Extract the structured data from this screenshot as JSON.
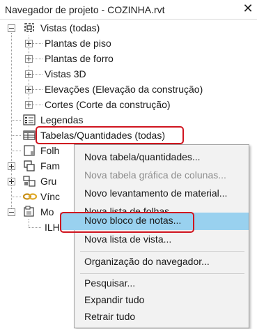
{
  "window": {
    "title": "Navegador de projeto - COZINHA.rvt",
    "close_glyph": "✕"
  },
  "tree": {
    "views_root": "Vistas (todas)",
    "views_children": [
      "Plantas de piso",
      "Plantas de forro",
      "Vistas 3D",
      "Elevações (Elevação da construção)",
      "Cortes (Corte da construção)"
    ],
    "legends": "Legendas",
    "schedules": "Tabelas/Quantidades (todas)",
    "sheets_partial": "Folh",
    "families_partial": "Fam",
    "groups_partial": "Gru",
    "links_partial": "Vínc",
    "model_partial": "Mo",
    "model_child_partial": "ILH"
  },
  "context_menu": {
    "items": [
      {
        "label": "Nova tabela/quantidades...",
        "enabled": true
      },
      {
        "label": "Nova tabela gráfica de colunas...",
        "enabled": false
      },
      {
        "label": "Novo levantamento de material...",
        "enabled": true
      },
      {
        "label": "Nova lista de folhas...",
        "enabled": true
      },
      {
        "label": "Novo bloco de notas...",
        "enabled": true,
        "highlighted": true
      },
      {
        "label": "Nova lista de vista...",
        "enabled": true
      },
      {
        "label": "Organização do navegador...",
        "enabled": true
      },
      {
        "label": "Pesquisar...",
        "enabled": true
      },
      {
        "label": "Expandir tudo",
        "enabled": true
      },
      {
        "label": "Retrair tudo",
        "enabled": true
      }
    ]
  },
  "colors": {
    "highlight": "#99d1ef",
    "annotation_red": "#d0141f",
    "menu_bg": "#f2f2f2",
    "disabled_text": "#8d8d8d"
  },
  "icons": [
    "close-icon",
    "views-icon",
    "legend-icon",
    "schedule-icon",
    "sheets-icon",
    "families-icon",
    "groups-icon",
    "links-icon",
    "model-icon"
  ]
}
